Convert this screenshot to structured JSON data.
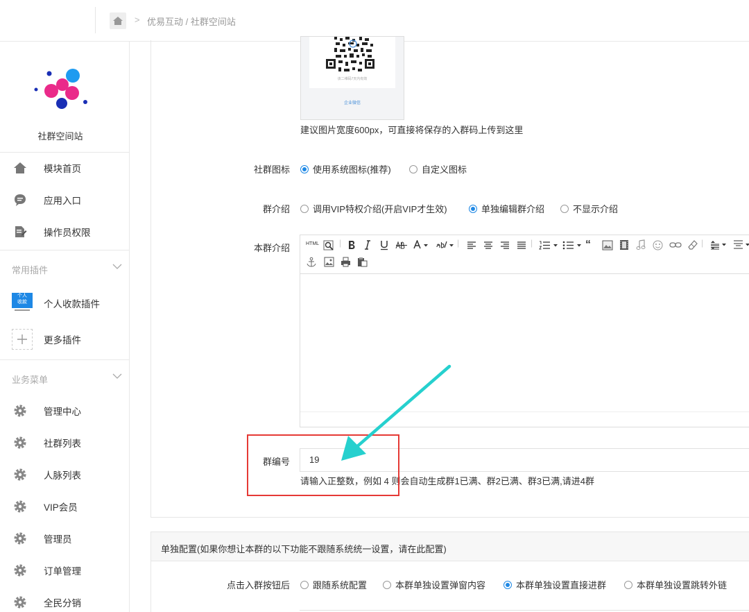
{
  "breadcrumb": {
    "path": "优易互动 / 社群空间站"
  },
  "sidebar": {
    "site_name": "社群空间站",
    "top_items": [
      {
        "label": "模块首页",
        "icon": "home-icon"
      },
      {
        "label": "应用入口",
        "icon": "chat-icon"
      },
      {
        "label": "操作员权限",
        "icon": "edit-doc-icon"
      }
    ],
    "plugins_title": "常用插件",
    "plugins": [
      {
        "label": "个人收款插件",
        "icon": "payment-plugin-icon",
        "icon_text_1": "个人",
        "icon_text_2": "收款"
      },
      {
        "label": "更多插件",
        "icon": "plus-icon"
      }
    ],
    "business_title": "业务菜单",
    "business": [
      {
        "label": "管理中心",
        "icon": "gear-icon"
      },
      {
        "label": "社群列表",
        "icon": "gear-icon"
      },
      {
        "label": "人脉列表",
        "icon": "gear-icon"
      },
      {
        "label": "VIP会员",
        "icon": "gear-icon"
      },
      {
        "label": "管理员",
        "icon": "gear-icon"
      },
      {
        "label": "订单管理",
        "icon": "gear-icon"
      },
      {
        "label": "全民分销",
        "icon": "gear-icon"
      }
    ]
  },
  "form": {
    "qr_brand": "企业微信",
    "qr_caption": "该二维码7天内有效",
    "qr_hint": "建议图片宽度600px，可直接将保存的入群码上传到这里",
    "icon_label": "社群图标",
    "icon_options": [
      {
        "label": "使用系统图标(推荐)",
        "checked": true
      },
      {
        "label": "自定义图标",
        "checked": false
      }
    ],
    "intro_label": "群介绍",
    "intro_options": [
      {
        "label": "调用VIP特权介绍(开启VIP才生效)",
        "checked": false
      },
      {
        "label": "单独编辑群介绍",
        "checked": true
      },
      {
        "label": "不显示介绍",
        "checked": false
      }
    ],
    "this_intro_label": "本群介绍",
    "group_no_label": "群编号",
    "group_no_value": "19",
    "group_no_hint": "请输入正整数，例如 4 则会自动生成群1已满、群2已满、群3已满,请进4群"
  },
  "separate_config": {
    "title": "单独配置(如果你想让本群的以下功能不跟随系统统一设置，请在此配置)",
    "join_label": "点击入群按钮后",
    "join_options": [
      {
        "label": "跟随系统配置",
        "checked": false
      },
      {
        "label": "本群单独设置弹窗内容",
        "checked": false
      },
      {
        "label": "本群单独设置直接进群",
        "checked": true
      },
      {
        "label": "本群单独设置跳转外链",
        "checked": false
      }
    ]
  },
  "colors": {
    "accent": "#1e88e5",
    "highlight_box": "#e53935",
    "arrow": "#26d0ce"
  }
}
